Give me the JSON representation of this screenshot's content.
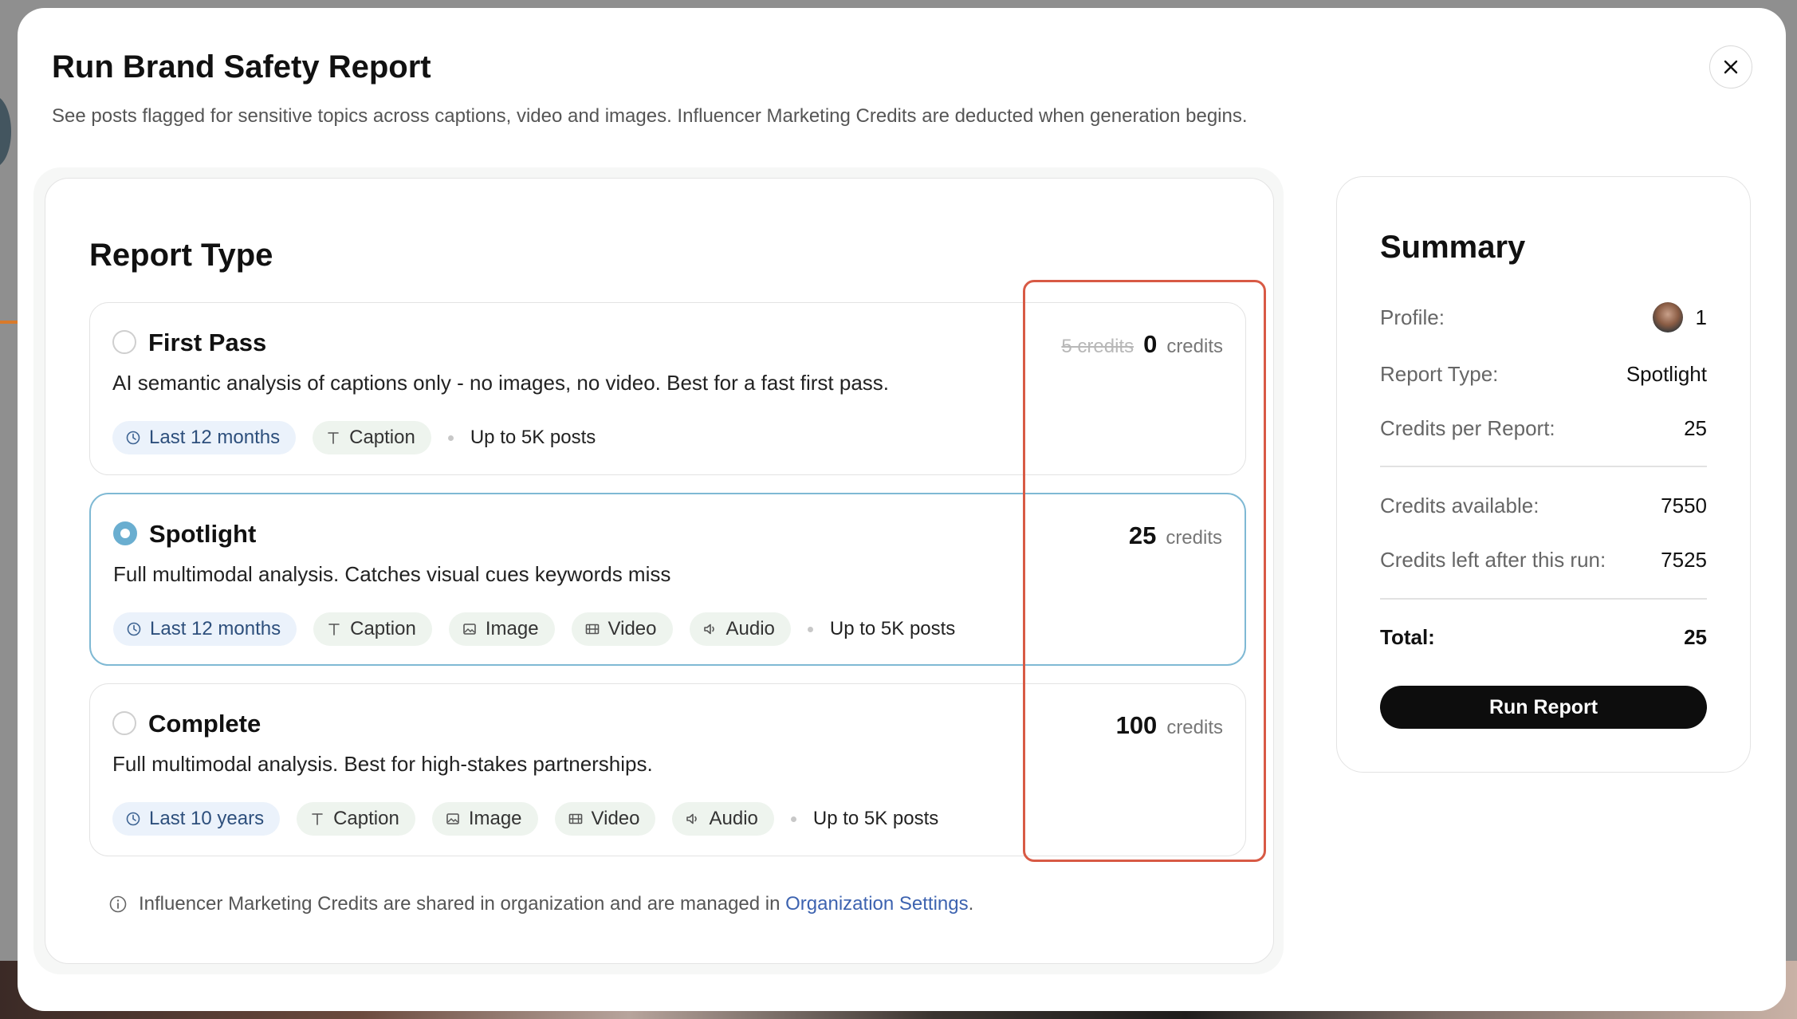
{
  "modal": {
    "title": "Run Brand Safety Report",
    "subtitle": "See posts flagged for sensitive topics across captions, video and images. Influencer Marketing Credits are deducted when generation begins."
  },
  "report_type": {
    "title": "Report Type",
    "credits_word": "credits",
    "options": [
      {
        "name": "First Pass",
        "description": "AI semantic analysis of captions only - no images, no video. Best for a fast first pass.",
        "old_credits": "5 credits",
        "credits": "0",
        "selected": false,
        "period": "Last 12 months",
        "features": [
          "Caption"
        ],
        "posts": "Up to 5K posts"
      },
      {
        "name": "Spotlight",
        "description": "Full multimodal analysis. Catches visual cues keywords miss",
        "credits": "25",
        "selected": true,
        "period": "Last 12 months",
        "features": [
          "Caption",
          "Image",
          "Video",
          "Audio"
        ],
        "posts": "Up to 5K posts"
      },
      {
        "name": "Complete",
        "description": "Full multimodal analysis. Best for high-stakes partnerships.",
        "credits": "100",
        "selected": false,
        "period": "Last 10 years",
        "features": [
          "Caption",
          "Image",
          "Video",
          "Audio"
        ],
        "posts": "Up to 5K posts"
      }
    ],
    "footnote": "Influencer Marketing Credits are shared in organization and are managed in",
    "footnote_link": "Organization Settings",
    "footnote_end": "."
  },
  "summary": {
    "title": "Summary",
    "profile_label": "Profile:",
    "profile_value": "1",
    "report_type_label": "Report Type:",
    "report_type_value": "Spotlight",
    "credits_per_report_label": "Credits per Report:",
    "credits_per_report_value": "25",
    "credits_available_label": "Credits available:",
    "credits_available_value": "7550",
    "credits_left_label": "Credits left after this run:",
    "credits_left_value": "7525",
    "total_label": "Total:",
    "total_value": "25",
    "run_button": "Run Report"
  },
  "colors": {
    "accent_selected": "#6aaed0",
    "highlight_box": "#d85a45",
    "link": "#3d63b0",
    "button": "#0d0d0d"
  },
  "icons": {
    "close": "close-icon",
    "clock": "clock-icon",
    "caption": "text-t-icon",
    "image": "image-icon",
    "video": "film-icon",
    "audio": "speaker-icon",
    "info": "info-icon"
  }
}
